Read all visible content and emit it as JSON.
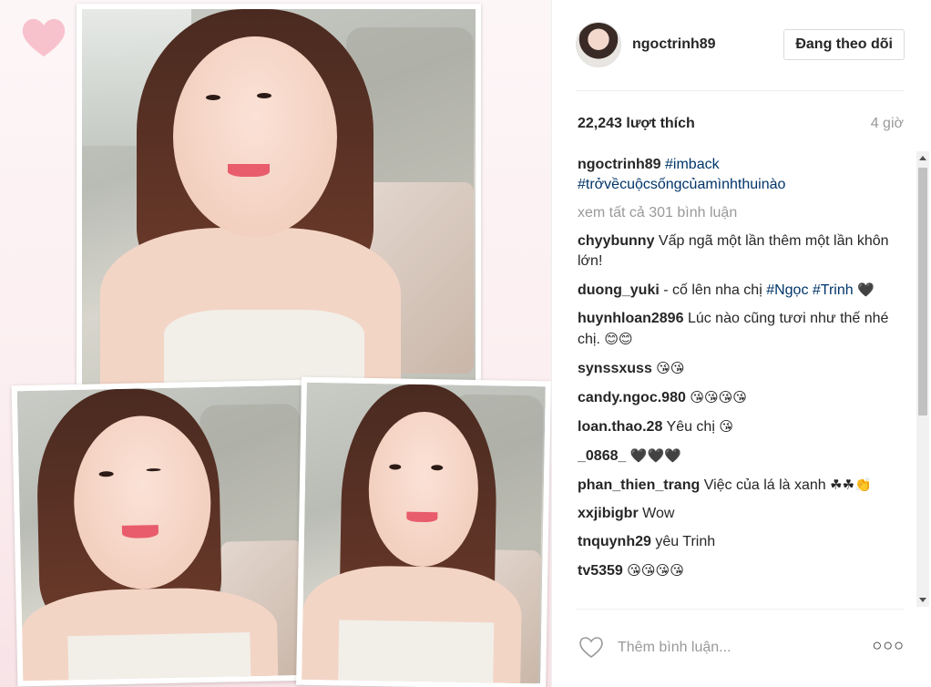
{
  "post": {
    "username": "ngoctrinh89",
    "follow_label": "Đang theo dõi",
    "likes": "22,243 lượt thích",
    "time": "4 giờ",
    "caption": {
      "user": "ngoctrinh89",
      "tag1": "#imback",
      "tag2": "#trởvềcuộcsốngcủamìnhthuinào"
    },
    "view_all": "xem tất cả 301 bình luận",
    "comments": [
      {
        "user": "chyybunny",
        "text": "Vấp ngã một lần thêm một lần khôn lớn!"
      },
      {
        "user": "duong_yuki",
        "text": "- cố lên nha chị",
        "tag": "#Ngọc #Trinh",
        "emoji": "🖤"
      },
      {
        "user": "huynhloan2896",
        "text": "Lúc nào cũng tươi như thế nhé chị.",
        "emoji": "😊😊"
      },
      {
        "user": "synssxuss",
        "text": "",
        "emoji": "😘😘"
      },
      {
        "user": "candy.ngoc.980",
        "text": "",
        "emoji": "😘😘😘😘"
      },
      {
        "user": "loan.thao.28",
        "text": "Yêu chị",
        "emoji": "😘"
      },
      {
        "user": "_0868_",
        "text": "",
        "emoji": "🖤🖤🖤"
      },
      {
        "user": "phan_thien_trang",
        "text": "Việc của lá là xanh",
        "emoji": "☘☘👏"
      },
      {
        "user": "xxjibigbr",
        "text": "Wow"
      },
      {
        "user": "tnquynh29",
        "text": "yêu Trinh"
      },
      {
        "user": "tv5359",
        "text": "",
        "emoji": "😘😘😘😘"
      }
    ],
    "comment_placeholder": "Thêm bình luận...",
    "more_label": "○○○"
  },
  "icons": {
    "like": "heart-outline-icon",
    "more": "ellipsis-icon"
  }
}
